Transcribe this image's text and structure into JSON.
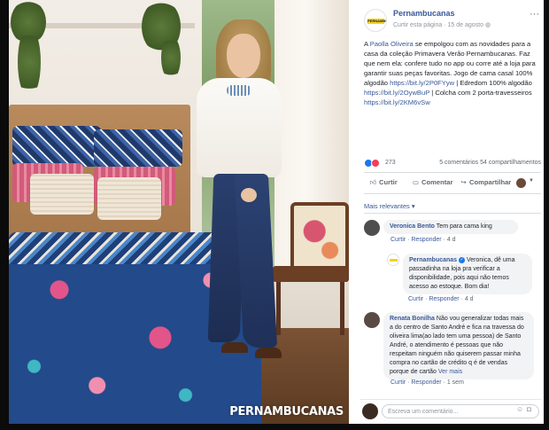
{
  "post": {
    "page_name": "Pernambucanas",
    "follow_link": "Curtir esta página",
    "separator": "·",
    "date": "15 de agosto",
    "privacy_icon": "globe-icon",
    "brand_yellow": "#f4d21f",
    "logo_text": "PERNAMBUCANAS",
    "text": {
      "part1": "A ",
      "mention": "Paolla Oliveira",
      "part2": " se empolgou com as novidades para a casa da coleção Primavera Verão Pernambucanas. Faz que nem ela: confere tudo no app ou corre até a loja para garantir suas peças favoritas. Jogo de cama casal 100% algodão ",
      "link1": "https://bit.ly/2P0FYyw",
      "part3": " | Edredom 100% algodão ",
      "link2": "https://bit.ly/2OywBuP",
      "part4": " | Colcha com 2 porta-travesseiros ",
      "link3": "https://bit.ly/2KM6vSw"
    }
  },
  "image": {
    "watermark": "PERNAMBUCANAS"
  },
  "reactions": {
    "count": "273",
    "comments": "5 comentários",
    "shares": "54 compartilhamentos",
    "like_color": "#1877f2",
    "love_color": "#f33e58"
  },
  "actions": {
    "like": "Curtir",
    "comment": "Comentar",
    "share": "Compartilhar"
  },
  "sort_label": "Mais relevantes",
  "sort_caret": "▾",
  "comments": [
    {
      "name": "Veronica Bento",
      "text": "Tem para cama king",
      "like": "Curtir",
      "reply": "Responder",
      "time": "4 d"
    },
    {
      "name": "Pernambucanas",
      "text": "Veronica, dê uma passadinha na loja pra verificar a disponibilidade, pois aqui não temos acesso ao estoque. Bom dia!",
      "like": "Curtir",
      "reply": "Responder",
      "time": "4 d"
    },
    {
      "name": "Renata Bonilha",
      "text": "Não vou generalizar todas mais a do centro de Santo André e fica na travessa do oliveira lima(ao lado tem uma pessoa) de Santo André, o atendimento é pessoas que não respeitam ninguém não quiserem passar minha compra no cartão de crédito q é de vendas porque de cartão",
      "see_more": "Ver mais",
      "like": "Curtir",
      "reply": "Responder",
      "time": "1 sem"
    }
  ],
  "write_comment": {
    "placeholder": "Escreva um comentário..."
  }
}
